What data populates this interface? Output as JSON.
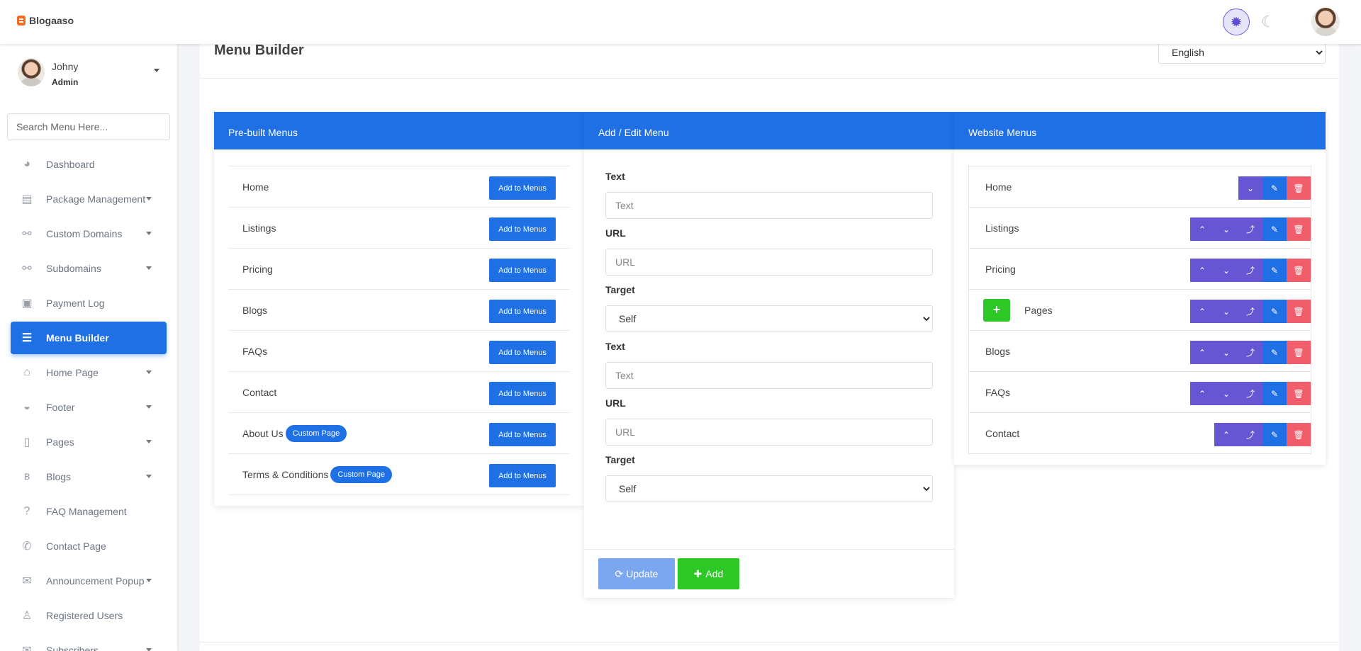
{
  "app": {
    "logo_text": "Blogaaso"
  },
  "topbar": {
    "light_icon": "sun-icon",
    "dark_icon": "moon-icon"
  },
  "user": {
    "name": "Johny",
    "role": "Admin"
  },
  "sidebar": {
    "search_placeholder": "Search Menu Here...",
    "items": [
      {
        "label": "Dashboard",
        "icon": "◕",
        "caret": false
      },
      {
        "label": "Package Management",
        "icon": "▤",
        "caret": true
      },
      {
        "label": "Custom Domains",
        "icon": "⚯",
        "caret": true
      },
      {
        "label": "Subdomains",
        "icon": "⚯",
        "caret": true
      },
      {
        "label": "Payment Log",
        "icon": "▣",
        "caret": false
      },
      {
        "label": "Menu Builder",
        "icon": "☰",
        "caret": false,
        "active": true
      },
      {
        "label": "Home Page",
        "icon": "⌂",
        "caret": true
      },
      {
        "label": "Footer",
        "icon": "◒",
        "caret": true
      },
      {
        "label": "Pages",
        "icon": "▯",
        "caret": true
      },
      {
        "label": "Blogs",
        "icon": "ʙ",
        "caret": true
      },
      {
        "label": "FAQ Management",
        "icon": "?",
        "caret": false
      },
      {
        "label": "Contact Page",
        "icon": "✆",
        "caret": false
      },
      {
        "label": "Announcement Popup",
        "icon": "✉",
        "caret": true
      },
      {
        "label": "Registered Users",
        "icon": "♙",
        "caret": false
      },
      {
        "label": "Subscribers",
        "icon": "✉",
        "caret": true
      }
    ]
  },
  "main": {
    "title": "Menu Builder",
    "language": "English",
    "prebuilt": {
      "title": "Pre-built Menus",
      "button_label": "Add to Menus",
      "items": [
        {
          "label": "Home",
          "badge": ""
        },
        {
          "label": "Listings",
          "badge": ""
        },
        {
          "label": "Pricing",
          "badge": ""
        },
        {
          "label": "Blogs",
          "badge": ""
        },
        {
          "label": "FAQs",
          "badge": ""
        },
        {
          "label": "Contact",
          "badge": ""
        },
        {
          "label": "About Us",
          "badge": "Custom Page"
        },
        {
          "label": "Terms & Conditions",
          "badge": "Custom Page"
        }
      ]
    },
    "editor": {
      "title": "Add / Edit Menu",
      "text_label": "Text",
      "text_placeholder": "Text",
      "url_label": "URL",
      "url_placeholder": "URL",
      "target_label": "Target",
      "target_value": "Self",
      "update_label": "Update",
      "add_label": "Add"
    },
    "website": {
      "title": "Website Menus",
      "items": [
        {
          "label": "Home",
          "actions": [
            "down"
          ],
          "plus": false
        },
        {
          "label": "Listings",
          "actions": [
            "up",
            "down",
            "out"
          ],
          "plus": false
        },
        {
          "label": "Pricing",
          "actions": [
            "up",
            "down",
            "out"
          ],
          "plus": false
        },
        {
          "label": "Pages",
          "actions": [
            "up",
            "down",
            "out"
          ],
          "plus": true
        },
        {
          "label": "Blogs",
          "actions": [
            "up",
            "down",
            "out"
          ],
          "plus": false
        },
        {
          "label": "FAQs",
          "actions": [
            "up",
            "down",
            "out"
          ],
          "plus": false
        },
        {
          "label": "Contact",
          "actions": [
            "up",
            "out"
          ],
          "plus": false
        }
      ]
    }
  }
}
